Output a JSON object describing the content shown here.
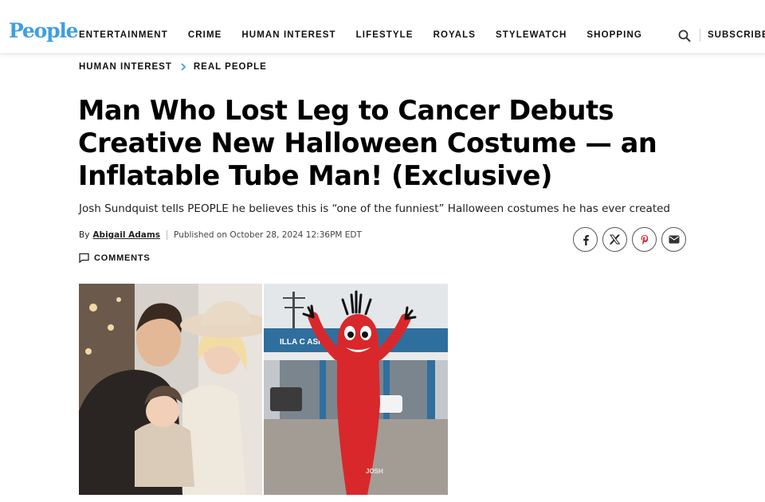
{
  "header": {
    "logo": "People",
    "nav": [
      "ENTERTAINMENT",
      "CRIME",
      "HUMAN INTEREST",
      "LIFESTYLE",
      "ROYALS",
      "STYLEWATCH",
      "SHOPPING"
    ],
    "subscribe_label": "SUBSCRIBE",
    "search_icon": "search-icon"
  },
  "breadcrumb": [
    "HUMAN INTEREST",
    "REAL PEOPLE"
  ],
  "article": {
    "title": "Man Who Lost Leg to Cancer Debuts Creative New Halloween Costume — an Inflatable Tube Man! (Exclusive)",
    "subtitle": "Josh Sundquist tells PEOPLE he believes this is “one of the funniest” Halloween costumes he has ever created",
    "byline_prefix": "By",
    "author": "Abigail Adams",
    "published": "Published on October 28, 2024 12:36PM EDT",
    "comments_label": "COMMENTS"
  },
  "share": {
    "facebook_icon": "facebook-icon",
    "x_icon": "x-icon",
    "pinterest_icon": "pinterest-icon",
    "email_icon": "email-icon"
  },
  "images": {
    "right_sign": "ILLA  C    ASH",
    "watermark": "JOSH"
  },
  "colors": {
    "logo_blue": "#3f9fdf",
    "breadcrumb_chevron": "#3f9fdf",
    "costume_red": "#d8282b"
  }
}
